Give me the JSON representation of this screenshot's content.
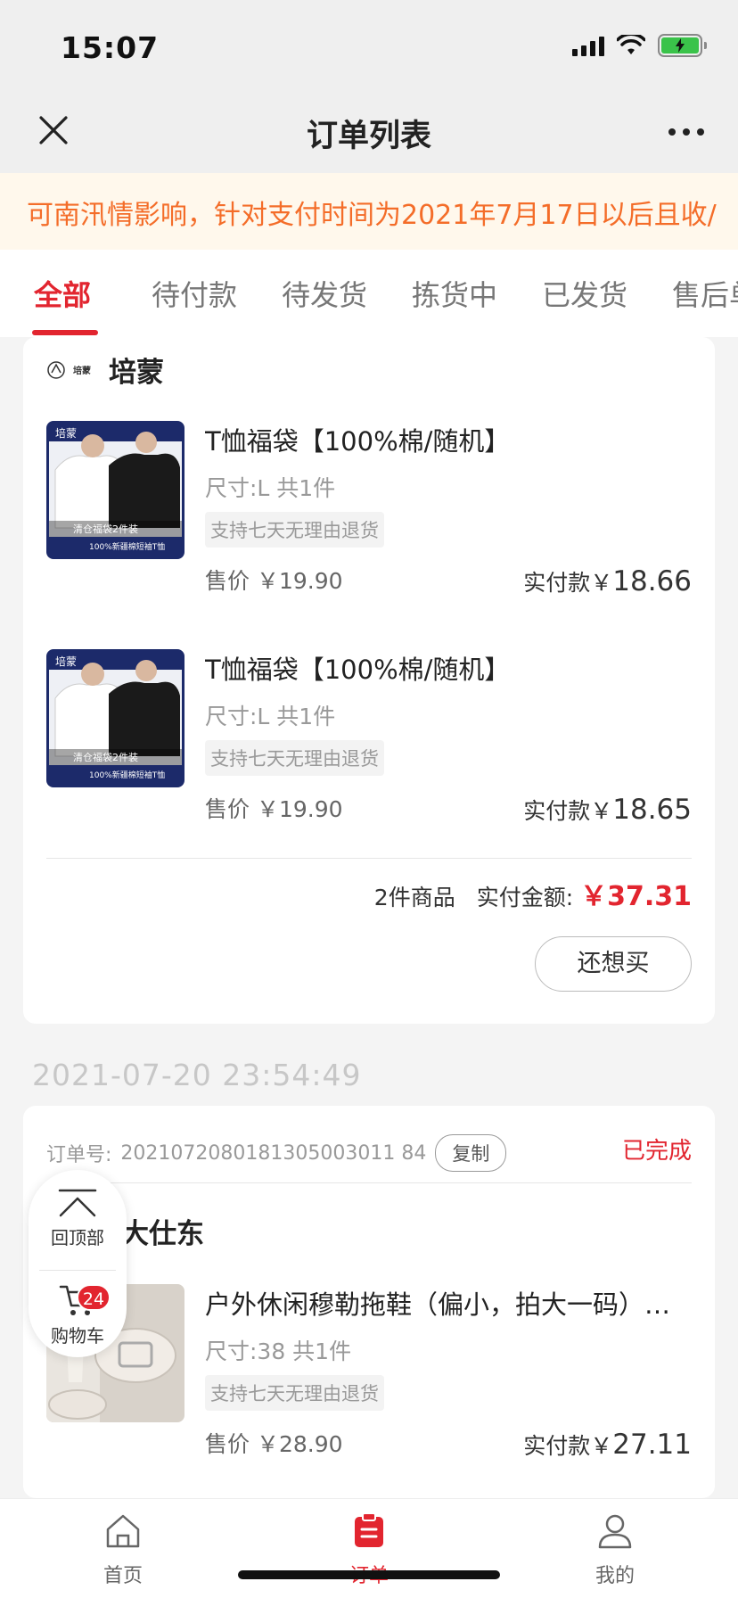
{
  "status_bar": {
    "time": "15:07"
  },
  "nav": {
    "title": "订单列表"
  },
  "notice": {
    "text": "可南汛情影响，针对支付时间为2021年7月17日以后且收/"
  },
  "tabs": [
    {
      "label": "全部"
    },
    {
      "label": "待付款"
    },
    {
      "label": "待发货"
    },
    {
      "label": "拣货中"
    },
    {
      "label": "已发货"
    },
    {
      "label": "售后单"
    }
  ],
  "order1": {
    "shop_name": "培蒙",
    "shop_logo_text": "培蒙",
    "products": [
      {
        "title": "T恤福袋【100%棉/随机】",
        "spec": "尺寸:L   共1件",
        "tag": "支持七天无理由退货",
        "price": "售价 ￥19.90",
        "paid_label": "实付款￥",
        "paid_value": "18.66",
        "image_caption": "清仓福袋2件装",
        "image_banner": "100%新疆棉短袖T恤"
      },
      {
        "title": "T恤福袋【100%棉/随机】",
        "spec": "尺寸:L   共1件",
        "tag": "支持七天无理由退货",
        "price": "售价 ￥19.90",
        "paid_label": "实付款￥",
        "paid_value": "18.65",
        "image_caption": "清仓福袋2件装",
        "image_banner": "100%新疆棉短袖T恤"
      }
    ],
    "item_count": "2件商品",
    "total_label": "实付金额:",
    "total_value": "￥37.31",
    "again_button": "还想买"
  },
  "order2": {
    "date": "2021-07-20 23:54:49",
    "order_no_label": "订单号:",
    "order_no": "2021072080181305003011 84",
    "copy_button": "复制",
    "status": "已完成",
    "shop_name": "大仕东",
    "product": {
      "title": "户外休闲穆勒拖鞋（偏小，拍大一码）…",
      "spec": "尺寸:38   共1件",
      "tag": "支持七天无理由退货",
      "price": "售价 ￥28.90",
      "paid_label": "实付款￥",
      "paid_value": "27.11"
    }
  },
  "floater": {
    "top_label": "回顶部",
    "cart_label": "购物车",
    "cart_badge": "24"
  },
  "tabbar": [
    {
      "label": "首页",
      "icon": "home-icon"
    },
    {
      "label": "订单",
      "icon": "order-icon"
    },
    {
      "label": "我的",
      "icon": "user-icon"
    }
  ],
  "colors": {
    "accent": "#e2252f",
    "notice": "#f46d29",
    "notice_bg": "#fff8ec",
    "background": "#f4f4f4"
  }
}
